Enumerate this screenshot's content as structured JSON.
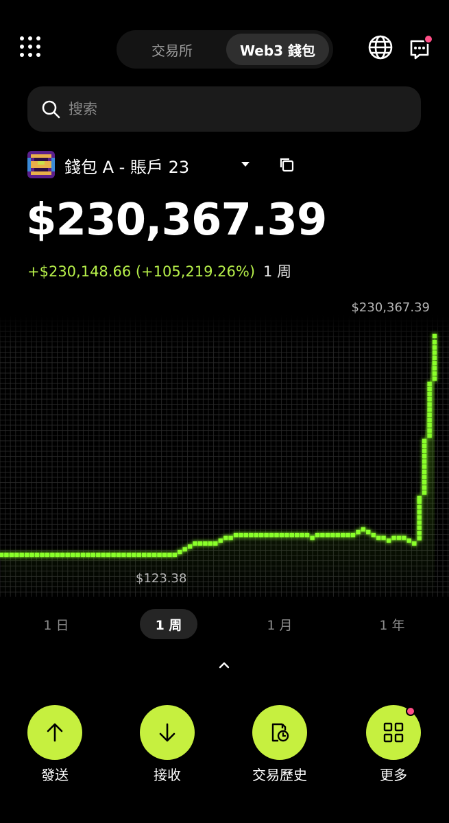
{
  "header": {
    "tabs": [
      {
        "label": "交易所",
        "active": false
      },
      {
        "label": "Web3 錢包",
        "active": true
      }
    ],
    "icons": [
      "apps-grid-icon",
      "globe-icon",
      "message-icon"
    ],
    "notification_color": "#ff4f87"
  },
  "search": {
    "placeholder": "搜索"
  },
  "wallet": {
    "name": "錢包 A - 賬戶 23",
    "balance": "$230,367.39",
    "change": "+$230,148.66 (+105,219.26%)",
    "change_period": "1 周"
  },
  "chart_data": {
    "type": "line",
    "series": [
      {
        "values": [
          123.38,
          123.38,
          123.38,
          123.38,
          123.38,
          123.38,
          123.38,
          123.38,
          123.38,
          123.38,
          123.38,
          123.38,
          123.38,
          123.38,
          123.38,
          123.38,
          123.38,
          123.38,
          123.38,
          123.38,
          123.38,
          123.38,
          123.38,
          123.38,
          123.38,
          123.38,
          123.38,
          123.38,
          123.38,
          123.38,
          123.38,
          123.38,
          123.38,
          123.38,
          123.38,
          3000,
          6000,
          9000,
          12000,
          12000,
          12000,
          12000,
          12000,
          15000,
          18000,
          18000,
          21000,
          21000,
          21000,
          21000,
          21000,
          21000,
          21000,
          21000,
          21000,
          21000,
          21000,
          21000,
          21000,
          21000,
          21000,
          18000,
          21000,
          21000,
          21000,
          21000,
          21000,
          21000,
          21000,
          21000,
          24000,
          27000,
          24000,
          21000,
          18000,
          18000,
          15000,
          18000,
          18000,
          18000,
          15000,
          12000,
          60000,
          120000,
          180000,
          230367.39
        ]
      }
    ],
    "max_label": "$230,367.39",
    "min_label": "$123.38",
    "accent_color": "#8aff2a",
    "grid": true
  },
  "ranges": [
    {
      "label": "1 日",
      "active": false
    },
    {
      "label": "1 周",
      "active": true
    },
    {
      "label": "1 月",
      "active": false
    },
    {
      "label": "1 年",
      "active": false
    }
  ],
  "actions": [
    {
      "label": "發送",
      "icon": "arrow-up-icon",
      "badge": false
    },
    {
      "label": "接收",
      "icon": "arrow-down-icon",
      "badge": false
    },
    {
      "label": "交易歷史",
      "icon": "history-icon",
      "badge": false
    },
    {
      "label": "更多",
      "icon": "grid-more-icon",
      "badge": true
    }
  ],
  "accent_color": "#c6f03f"
}
